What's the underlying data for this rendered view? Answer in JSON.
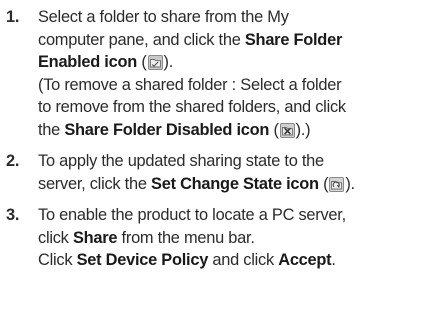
{
  "steps": [
    {
      "number": "1.",
      "line1": "Select a folder to share from the My",
      "line2_text": "computer pane, and click the ",
      "line2_bold": "Share Folder",
      "line3_bold": "Enabled icon",
      "line3_open": " (",
      "line3_close": ").",
      "line4": "(To remove a shared folder : Select a folder",
      "line5": "to remove from the shared folders, and click",
      "line6_pre": "the ",
      "line6_bold": "Share Folder Disabled icon",
      "line6_open": " (",
      "line6_close": ").)"
    },
    {
      "number": "2.",
      "line1": "To apply the updated sharing state to the",
      "line2_text": "server, click the ",
      "line2_bold": "Set Change State icon",
      "line2_open": " (",
      "line2_close": ")."
    },
    {
      "number": "3.",
      "line1": "To enable the product to locate a PC server,",
      "line2_pre": "click ",
      "line2_bold": "Share",
      "line2_post": " from the menu bar.",
      "line3_pre": "Click ",
      "line3_bold1": "Set Device Policy",
      "line3_mid": " and click ",
      "line3_bold2": "Accept",
      "line3_end": "."
    }
  ],
  "icons": {
    "share_enabled": "share-folder-enabled-icon",
    "share_disabled": "share-folder-disabled-icon",
    "set_change_state": "set-change-state-icon"
  }
}
